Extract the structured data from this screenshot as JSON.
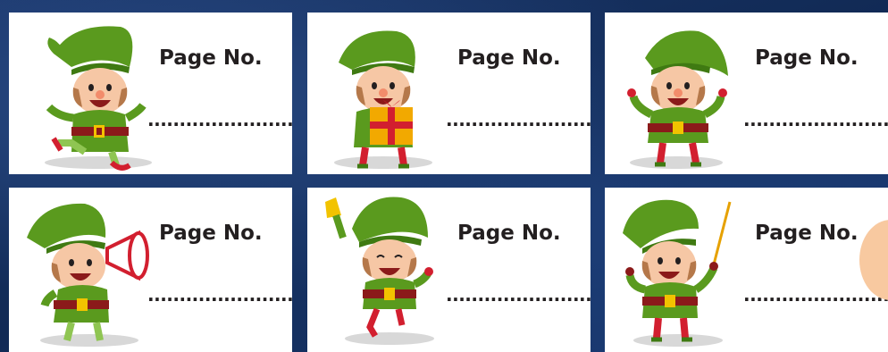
{
  "cards": [
    {
      "title": "Page No.",
      "blank": "........................",
      "pose": "dancing",
      "prop": "none"
    },
    {
      "title": "Page No.",
      "blank": "........................",
      "pose": "holding gift",
      "prop": "gift-box"
    },
    {
      "title": "Page No.",
      "blank": "........................",
      "pose": "thumbs up",
      "prop": "none"
    },
    {
      "title": "Page No.",
      "blank": "........................",
      "pose": "shouting",
      "prop": "megaphone"
    },
    {
      "title": "Page No.",
      "blank": "........................",
      "pose": "jumping with bell",
      "prop": "bell"
    },
    {
      "title": "Page No.",
      "blank": "........................",
      "pose": "pointing",
      "prop": "pointer-stick"
    }
  ],
  "colors": {
    "background": "#17305e",
    "card": "#ffffff",
    "elf_green": "#5a9a1e",
    "elf_dark_green": "#3f7a12",
    "belt": "#8b1a1a",
    "buckle": "#f2c300",
    "skin": "#f6c7a5",
    "hair": "#b5784a",
    "text": "#231f20",
    "accent_peach": "#f8c9a0"
  }
}
